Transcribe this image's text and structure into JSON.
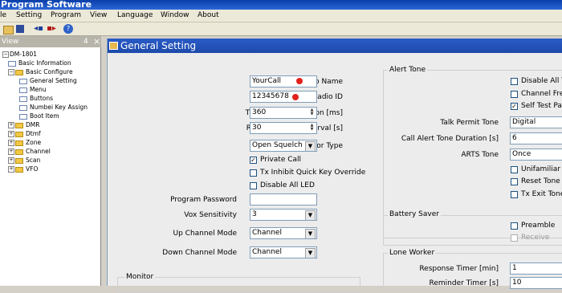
{
  "window": {
    "title": "Program Software"
  },
  "menu": [
    "le",
    "Setting",
    "Program",
    "View",
    "Language",
    "Window",
    "About"
  ],
  "tree": {
    "header": "View",
    "header_pin": "4",
    "close": "×",
    "items": [
      {
        "label": "DM-1801",
        "level": 0,
        "type": "minus"
      },
      {
        "label": "Basic Information",
        "level": 1,
        "type": "doc"
      },
      {
        "label": "Basic Configure",
        "level": 1,
        "type": "folder-minus"
      },
      {
        "label": "General Setting",
        "level": 2,
        "type": "doc"
      },
      {
        "label": "Menu",
        "level": 2,
        "type": "doc"
      },
      {
        "label": "Buttons",
        "level": 2,
        "type": "doc"
      },
      {
        "label": "Numbei Key Assign",
        "level": 2,
        "type": "doc"
      },
      {
        "label": "Boot Item",
        "level": 2,
        "type": "doc"
      },
      {
        "label": "DMR",
        "level": 1,
        "type": "folder"
      },
      {
        "label": "Dtmf",
        "level": 1,
        "type": "folder"
      },
      {
        "label": "Zone",
        "level": 1,
        "type": "folder"
      },
      {
        "label": "Channel",
        "level": 1,
        "type": "folder"
      },
      {
        "label": "Scan",
        "level": 1,
        "type": "folder"
      },
      {
        "label": "VFO",
        "level": 1,
        "type": "folder"
      }
    ]
  },
  "general": {
    "title": "General Setting",
    "radio_name": {
      "label": "Radio Name",
      "value": "YourCall"
    },
    "radio_id": {
      "label": "Radio ID",
      "value": "12345678"
    },
    "tx_preamble": {
      "label": "Tx Preamble Duration [ms]",
      "value": "360"
    },
    "rx_low_batt": {
      "label": "Rx Low Battery Interval [s]",
      "value": "30"
    },
    "monitor_type": {
      "label": "Monitor Type",
      "value": "Open Squelch"
    },
    "private_call": {
      "label": "Private Call",
      "checked": true
    },
    "tx_inhibit": {
      "label": "Tx Inhibit Quick Key Override",
      "checked": false
    },
    "disable_led": {
      "label": "Disable All LED",
      "checked": false
    },
    "program_password": {
      "label": "Program Password",
      "value": ""
    },
    "vox": {
      "label": "Vox Sensitivity",
      "value": "3"
    },
    "up_channel": {
      "label": "Up Channel Mode",
      "value": "Channel"
    },
    "down_channel": {
      "label": "Down Channel Mode",
      "value": "Channel"
    },
    "monitor_group": "Monitor"
  },
  "alert": {
    "title": "Alert Tone",
    "disable_all": "Disable All T",
    "channel_free": "Channel Fre",
    "self_test": "Self Test Pa",
    "talk_permit": {
      "label": "Talk Permit Tone",
      "value": "Digital"
    },
    "call_alert": {
      "label": "Call Alert Tone Duration [s]",
      "value": "6"
    },
    "arts": {
      "label": "ARTS Tone",
      "value": "Once"
    },
    "unfamiliar": "Unifamiliar N",
    "reset_tone": "Reset Tone",
    "tx_exit": "Tx Exit Tone"
  },
  "battery": {
    "title": "Battery Saver",
    "preamble": "Preamble",
    "receive": "Receive"
  },
  "lone": {
    "title": "Lone Worker",
    "response": {
      "label": "Response Timer [min]",
      "value": "1"
    },
    "reminder": {
      "label": "Reminder Timer [s]",
      "value": "10"
    }
  }
}
